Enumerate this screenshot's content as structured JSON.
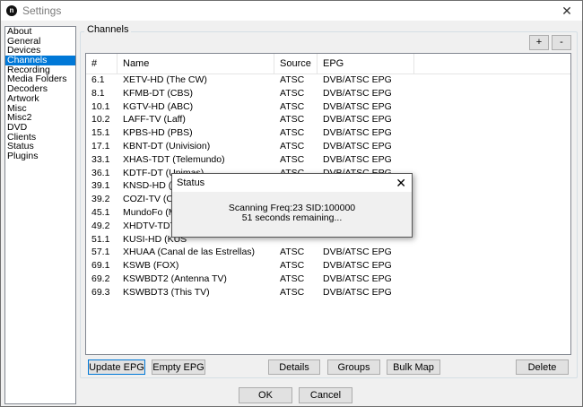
{
  "window": {
    "title": "Settings",
    "close_glyph": "✕",
    "icon_letter": "n"
  },
  "sidebar": {
    "items": [
      {
        "label": "About"
      },
      {
        "label": "General"
      },
      {
        "label": "Devices"
      },
      {
        "label": "Channels",
        "selected": true
      },
      {
        "label": "Recording"
      },
      {
        "label": "Media Folders"
      },
      {
        "label": "Decoders"
      },
      {
        "label": "Artwork"
      },
      {
        "label": "Misc"
      },
      {
        "label": "Misc2"
      },
      {
        "label": "DVD"
      },
      {
        "label": "Clients"
      },
      {
        "label": "Status"
      },
      {
        "label": "Plugins"
      }
    ]
  },
  "channels": {
    "group_label": "Channels",
    "add_label": "+",
    "remove_label": "-",
    "columns": [
      "#",
      "Name",
      "Source",
      "EPG"
    ],
    "rows": [
      {
        "num": "6.1",
        "name": "XETV-HD (The CW)",
        "source": "ATSC",
        "epg": "DVB/ATSC EPG"
      },
      {
        "num": "8.1",
        "name": "KFMB-DT (CBS)",
        "source": "ATSC",
        "epg": "DVB/ATSC EPG"
      },
      {
        "num": "10.1",
        "name": "KGTV-HD (ABC)",
        "source": "ATSC",
        "epg": "DVB/ATSC EPG"
      },
      {
        "num": "10.2",
        "name": "LAFF-TV (Laff)",
        "source": "ATSC",
        "epg": "DVB/ATSC EPG"
      },
      {
        "num": "15.1",
        "name": "KPBS-HD (PBS)",
        "source": "ATSC",
        "epg": "DVB/ATSC EPG"
      },
      {
        "num": "17.1",
        "name": "KBNT-DT (Univision)",
        "source": "ATSC",
        "epg": "DVB/ATSC EPG"
      },
      {
        "num": "33.1",
        "name": "XHAS-TDT (Telemundo)",
        "source": "ATSC",
        "epg": "DVB/ATSC EPG"
      },
      {
        "num": "36.1",
        "name": "KDTF-DT (Unimas)",
        "source": "ATSC",
        "epg": "DVB/ATSC EPG"
      },
      {
        "num": "39.1",
        "name": "KNSD-HD (NB",
        "source": "",
        "epg": ""
      },
      {
        "num": "39.2",
        "name": "COZI-TV (Cozi",
        "source": "",
        "epg": ""
      },
      {
        "num": "45.1",
        "name": "MundoFo (Mun",
        "source": "",
        "epg": ""
      },
      {
        "num": "49.2",
        "name": "XHDTV-TDT (",
        "source": "",
        "epg": ""
      },
      {
        "num": "51.1",
        "name": "KUSI-HD (KUS",
        "source": "",
        "epg": ""
      },
      {
        "num": "57.1",
        "name": "XHUAA (Canal de las Estrellas)",
        "source": "ATSC",
        "epg": "DVB/ATSC EPG"
      },
      {
        "num": "69.1",
        "name": "KSWB (FOX)",
        "source": "ATSC",
        "epg": "DVB/ATSC EPG"
      },
      {
        "num": "69.2",
        "name": "KSWBDT2 (Antenna TV)",
        "source": "ATSC",
        "epg": "DVB/ATSC EPG"
      },
      {
        "num": "69.3",
        "name": "KSWBDT3 (This TV)",
        "source": "ATSC",
        "epg": "DVB/ATSC EPG"
      }
    ],
    "buttons": {
      "update_epg": "Update EPG",
      "empty_epg": "Empty EPG",
      "details": "Details",
      "groups": "Groups",
      "bulk_map": "Bulk Map",
      "delete": "Delete"
    }
  },
  "footer": {
    "ok": "OK",
    "cancel": "Cancel"
  },
  "status_dialog": {
    "title": "Status",
    "close_glyph": "✕",
    "line1": "Scanning Freq:23 SID:100000",
    "line2": "51 seconds remaining..."
  }
}
